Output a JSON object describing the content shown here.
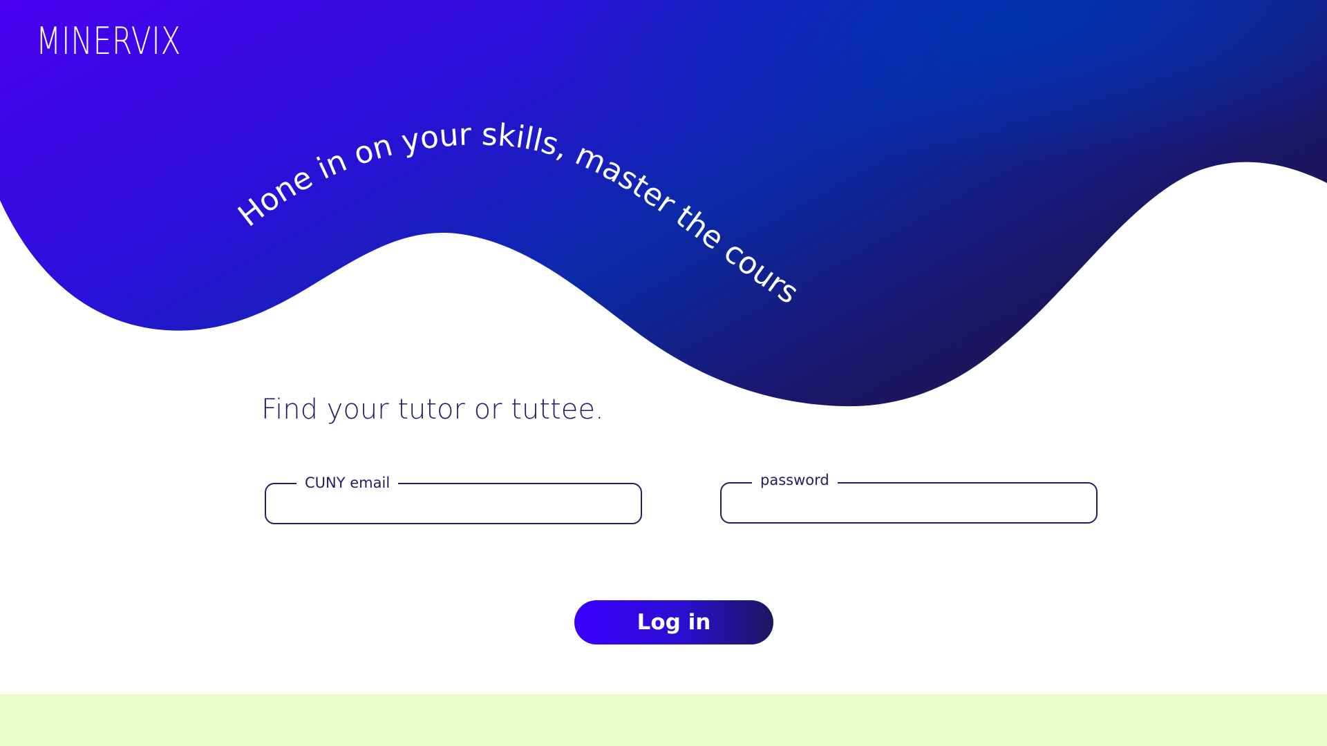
{
  "brand": {
    "logo_text": "MINERVIX"
  },
  "hero": {
    "tagline": "Hone in on your skills, master the course",
    "gradient_colors": [
      "#3a00ff",
      "#0029a8",
      "#1d1660"
    ]
  },
  "form": {
    "heading": "Find your tutor or tuttee.",
    "email_label": "CUNY email",
    "email_value": "",
    "password_label": "password",
    "password_value": "",
    "login_label": "Log in"
  },
  "colors": {
    "text_dark": "#2a1a66",
    "accent": "#3a00ff",
    "footer_band": "#ebfccb"
  }
}
